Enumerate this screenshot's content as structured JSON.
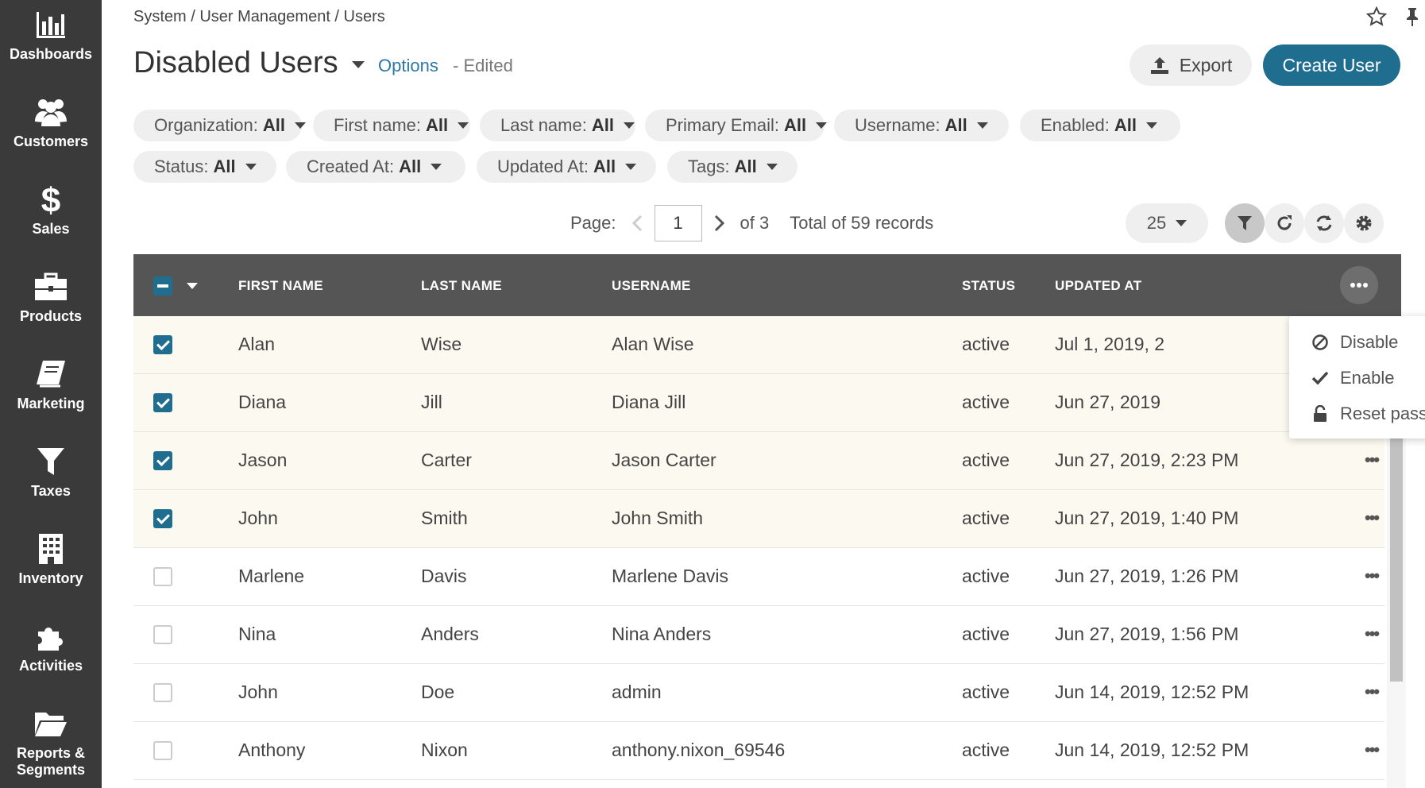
{
  "sidebar": {
    "items": [
      {
        "label": "Dashboards",
        "icon": "bar-chart-icon"
      },
      {
        "label": "Customers",
        "icon": "users-icon"
      },
      {
        "label": "Sales",
        "icon": "dollar-icon"
      },
      {
        "label": "Products",
        "icon": "briefcase-icon"
      },
      {
        "label": "Marketing",
        "icon": "book-icon"
      },
      {
        "label": "Taxes",
        "icon": "filter-icon"
      },
      {
        "label": "Inventory",
        "icon": "building-icon"
      },
      {
        "label": "Activities",
        "icon": "puzzle-icon"
      },
      {
        "label": "Reports &",
        "label2": "Segments",
        "icon": "folder-icon"
      }
    ]
  },
  "header": {
    "breadcrumb": "System / User Management / Users",
    "title": "Disabled Users",
    "options_link": "Options",
    "edited": "- Edited",
    "export_label": "Export",
    "create_label": "Create User"
  },
  "filters": [
    {
      "label": "Organization:",
      "value": "All"
    },
    {
      "label": "First name:",
      "value": "All"
    },
    {
      "label": "Last name:",
      "value": "All"
    },
    {
      "label": "Primary Email:",
      "value": "All"
    },
    {
      "label": "Username:",
      "value": "All"
    },
    {
      "label": "Enabled:",
      "value": "All"
    },
    {
      "label": "Status:",
      "value": "All"
    },
    {
      "label": "Created At:",
      "value": "All"
    },
    {
      "label": "Updated At:",
      "value": "All"
    },
    {
      "label": "Tags:",
      "value": "All"
    }
  ],
  "pagination": {
    "page_label": "Page:",
    "page": "1",
    "of_label": "of 3",
    "total": "Total of 59 records",
    "per_page": "25"
  },
  "table": {
    "columns": [
      "FIRST NAME",
      "LAST NAME",
      "USERNAME",
      "STATUS",
      "UPDATED AT"
    ],
    "rows": [
      {
        "checked": true,
        "first": "Alan",
        "last": "Wise",
        "username": "Alan Wise",
        "status": "active",
        "updated": "Jul 1, 2019, 2"
      },
      {
        "checked": true,
        "first": "Diana",
        "last": "Jill",
        "username": "Diana Jill",
        "status": "active",
        "updated": "Jun 27, 2019"
      },
      {
        "checked": true,
        "first": "Jason",
        "last": "Carter",
        "username": "Jason Carter",
        "status": "active",
        "updated": "Jun 27, 2019, 2:23 PM"
      },
      {
        "checked": true,
        "first": "John",
        "last": "Smith",
        "username": "John Smith",
        "status": "active",
        "updated": "Jun 27, 2019, 1:40 PM"
      },
      {
        "checked": false,
        "first": "Marlene",
        "last": "Davis",
        "username": "Marlene Davis",
        "status": "active",
        "updated": "Jun 27, 2019, 1:26 PM"
      },
      {
        "checked": false,
        "first": "Nina",
        "last": "Anders",
        "username": "Nina Anders",
        "status": "active",
        "updated": "Jun 27, 2019, 1:56 PM"
      },
      {
        "checked": false,
        "first": "John",
        "last": "Doe",
        "username": "admin",
        "status": "active",
        "updated": "Jun 14, 2019, 12:52 PM"
      },
      {
        "checked": false,
        "first": "Anthony",
        "last": "Nixon",
        "username": "anthony.nixon_69546",
        "status": "active",
        "updated": "Jun 14, 2019, 12:52 PM"
      }
    ]
  },
  "mass_actions": {
    "items": [
      {
        "label": "Disable",
        "icon": "ban-icon"
      },
      {
        "label": "Enable",
        "icon": "check-icon"
      },
      {
        "label": "Reset password",
        "icon": "unlock-icon"
      }
    ]
  },
  "colors": {
    "sidebar_bg": "#3a3a3a",
    "accent": "#1f6e8f",
    "table_header_bg": "#555555",
    "selected_row_bg": "#fcfaf0"
  }
}
